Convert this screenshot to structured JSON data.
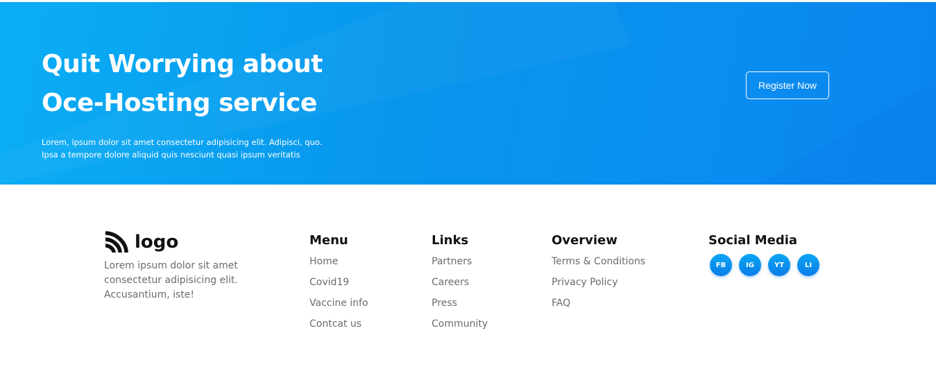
{
  "cta": {
    "title_line1": "Quit Worrying about",
    "title_line2": "Oce-Hosting service",
    "desc_line1": "Lorem, ipsum dolor sit amet consectetur adipisicing elit. Adipisci, quo.",
    "desc_line2": "Ipsa a tempore dolore aliquid quis nesciunt quasi ipsum veritatis",
    "button_label": "Register Now"
  },
  "footer": {
    "logo_text": "logo",
    "about_text": "Lorem ipsum dolor sit amet consectetur adipisicing elit. Accusantium, iste!",
    "menu": {
      "title": "Menu",
      "items": [
        "Home",
        "Covid19",
        "Vaccine info",
        "Contcat us"
      ]
    },
    "links": {
      "title": "Links",
      "items": [
        "Partners",
        "Careers",
        "Press",
        "Community"
      ]
    },
    "overview": {
      "title": "Overview",
      "items": [
        "Terms & Conditions",
        "Privacy Policy",
        "FAQ"
      ]
    },
    "social": {
      "title": "Social Media",
      "items": [
        "FB",
        "IG",
        "YT",
        "LI"
      ]
    }
  },
  "colors": {
    "brand_blue": "#0a95ee",
    "text_dark": "#111111",
    "text_muted": "#6b6b6b"
  }
}
